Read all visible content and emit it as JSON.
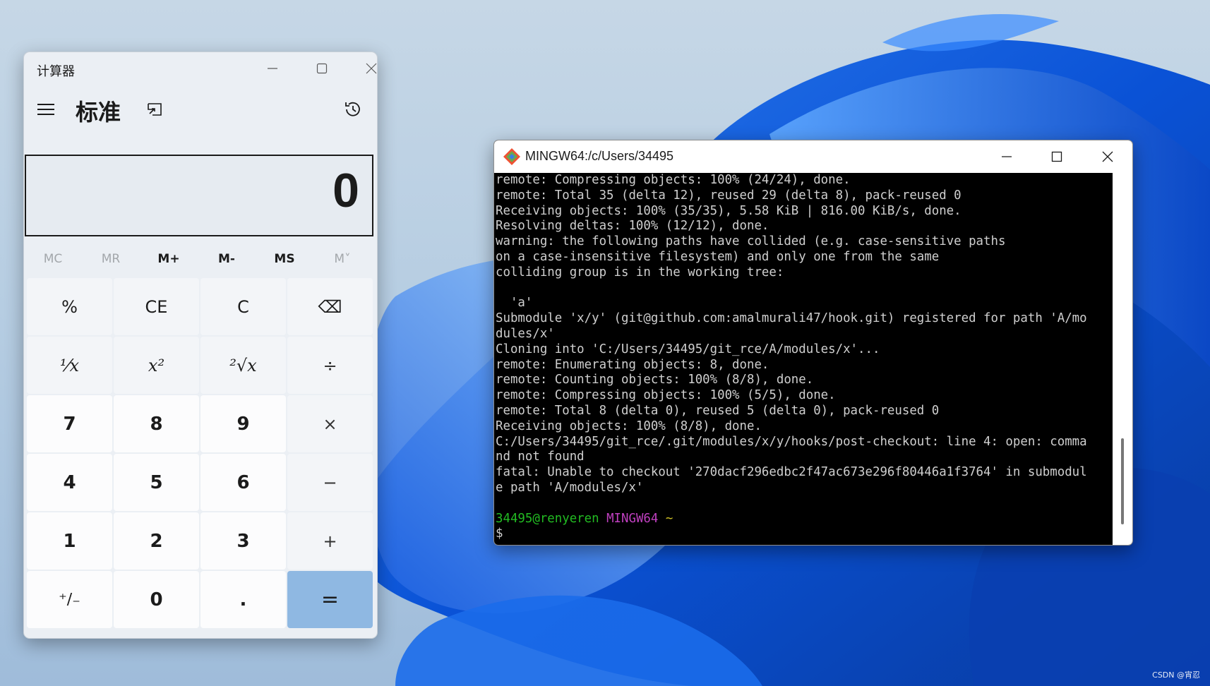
{
  "calculator": {
    "title": "计算器",
    "mode": "标准",
    "display": "0",
    "memory": [
      {
        "label": "MC",
        "enabled": false
      },
      {
        "label": "MR",
        "enabled": false
      },
      {
        "label": "M+",
        "enabled": true
      },
      {
        "label": "M-",
        "enabled": true
      },
      {
        "label": "MS",
        "enabled": true
      },
      {
        "label": "M˅",
        "enabled": false
      }
    ],
    "keys": {
      "percent": "%",
      "ce": "CE",
      "c": "C",
      "backspace": "⌫",
      "reciprocal": "¹⁄x",
      "square": "x²",
      "sqrt": "²√x",
      "divide": "÷",
      "seven": "7",
      "eight": "8",
      "nine": "9",
      "multiply": "×",
      "four": "4",
      "five": "5",
      "six": "6",
      "minus": "−",
      "one": "1",
      "two": "2",
      "three": "3",
      "plus": "+",
      "negate": "⁺∕₋",
      "zero": "0",
      "decimal": ".",
      "equals": "="
    }
  },
  "terminal": {
    "title": "MINGW64:/c/Users/34495",
    "lines": [
      "remote: Compressing objects: 100% (24/24), done.",
      "remote: Total 35 (delta 12), reused 29 (delta 8), pack-reused 0",
      "Receiving objects: 100% (35/35), 5.58 KiB | 816.00 KiB/s, done.",
      "Resolving deltas: 100% (12/12), done.",
      "warning: the following paths have collided (e.g. case-sensitive paths",
      "on a case-insensitive filesystem) and only one from the same",
      "colliding group is in the working tree:",
      "",
      "  'a'",
      "Submodule 'x/y' (git@github.com:amalmurali47/hook.git) registered for path 'A/mo",
      "dules/x'",
      "Cloning into 'C:/Users/34495/git_rce/A/modules/x'...",
      "remote: Enumerating objects: 8, done.",
      "remote: Counting objects: 100% (8/8), done.",
      "remote: Compressing objects: 100% (5/5), done.",
      "remote: Total 8 (delta 0), reused 5 (delta 0), pack-reused 0",
      "Receiving objects: 100% (8/8), done.",
      "C:/Users/34495/git_rce/.git/modules/x/y/hooks/post-checkout: line 4: open: comma",
      "nd not found",
      "fatal: Unable to checkout '270dacf296edbc2f47ac673e296f80446a1f3764' in submodul",
      "e path 'A/modules/x'",
      ""
    ],
    "prompt": {
      "user_host": "34495@renyeren",
      "env": "MINGW64",
      "path": "~",
      "symbol": "$"
    }
  },
  "watermark": "CSDN @宵忍",
  "colors": {
    "equals_key": "#8fb8e2",
    "prompt_user": "#22bb22",
    "prompt_env": "#c040c0",
    "prompt_path": "#cfc025"
  }
}
